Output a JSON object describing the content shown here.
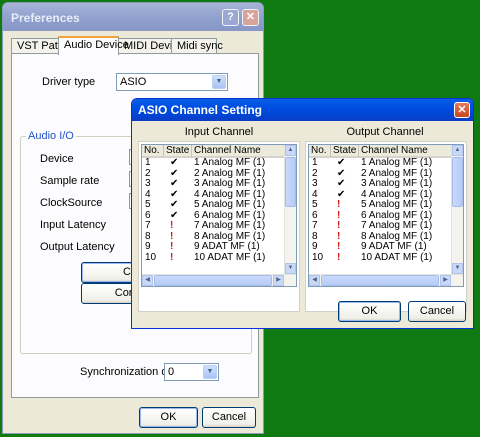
{
  "prefs": {
    "title": "Preferences",
    "help_glyph": "?",
    "close_glyph": "✕",
    "tabs": [
      "VST Path",
      "Audio Device",
      "MIDI Device",
      "Midi sync"
    ],
    "driver_type_label": "Driver type",
    "driver_type_value": "ASIO",
    "audio_io_title": "Audio I/O",
    "fields": [
      "Device",
      "Sample rate",
      "ClockSource",
      "Input Latency",
      "Output Latency"
    ],
    "btn_channel_partial": "Ch",
    "btn_control_partial": "Cont",
    "sync_delay_label": "Synchronization delay",
    "sync_delay_value": "0",
    "ok": "OK",
    "cancel": "Cancel"
  },
  "asio": {
    "title": "ASIO Channel Setting",
    "close_glyph": "✕",
    "input_title": "Input Channel",
    "output_title": "Output Channel",
    "columns": [
      "No.",
      "State",
      "Channel Name"
    ],
    "input_rows": [
      {
        "no": "1",
        "state": "ok",
        "name": "1 Analog MF (1)"
      },
      {
        "no": "2",
        "state": "ok",
        "name": "2 Analog MF (1)"
      },
      {
        "no": "3",
        "state": "ok",
        "name": "3 Analog MF (1)"
      },
      {
        "no": "4",
        "state": "ok",
        "name": "4 Analog MF (1)"
      },
      {
        "no": "5",
        "state": "ok",
        "name": "5 Analog MF (1)"
      },
      {
        "no": "6",
        "state": "ok",
        "name": "6 Analog MF (1)"
      },
      {
        "no": "7",
        "state": "warn",
        "name": "7 Analog MF (1)"
      },
      {
        "no": "8",
        "state": "warn",
        "name": "8 Analog MF (1)"
      },
      {
        "no": "9",
        "state": "warn",
        "name": "9 ADAT MF (1)"
      },
      {
        "no": "10",
        "state": "warn",
        "name": "10 ADAT MF (1)"
      }
    ],
    "output_rows": [
      {
        "no": "1",
        "state": "ok",
        "name": "1 Analog MF (1)"
      },
      {
        "no": "2",
        "state": "ok",
        "name": "2 Analog MF (1)"
      },
      {
        "no": "3",
        "state": "ok",
        "name": "3 Analog MF (1)"
      },
      {
        "no": "4",
        "state": "ok",
        "name": "4 Analog MF (1)"
      },
      {
        "no": "5",
        "state": "warn",
        "name": "5 Analog MF (1)"
      },
      {
        "no": "6",
        "state": "warn",
        "name": "6 Analog MF (1)"
      },
      {
        "no": "7",
        "state": "warn",
        "name": "7 Analog MF (1)"
      },
      {
        "no": "8",
        "state": "warn",
        "name": "8 Analog MF (1)"
      },
      {
        "no": "9",
        "state": "warn",
        "name": "9 ADAT MF (1)"
      },
      {
        "no": "10",
        "state": "warn",
        "name": "10 ADAT MF (1)"
      }
    ],
    "state_glyphs": {
      "ok": "✔",
      "warn": "!"
    },
    "ok": "OK",
    "cancel": "Cancel"
  }
}
